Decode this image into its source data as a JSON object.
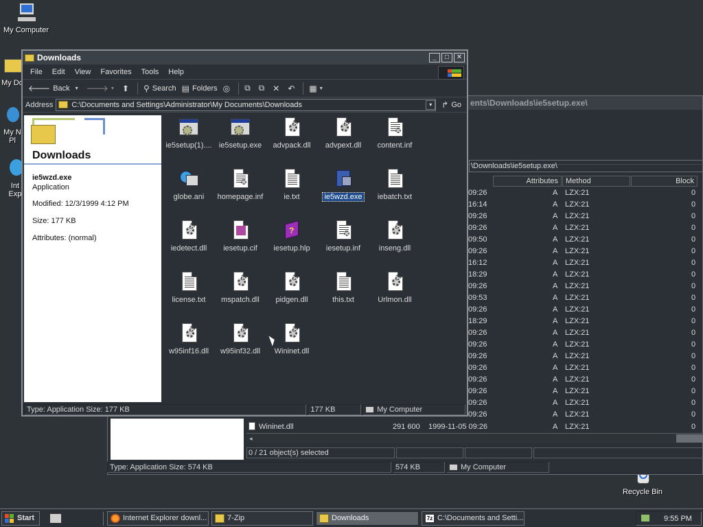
{
  "desktop": {
    "icons": [
      {
        "label": "My Computer",
        "icon": "my-computer-icon"
      },
      {
        "label": "My Do",
        "icon": "my-documents-icon"
      },
      {
        "label": "My N",
        "label2": "Pl",
        "icon": "my-network-places-icon"
      },
      {
        "label": "Int",
        "label2": "Exp",
        "icon": "internet-explorer-icon"
      },
      {
        "label": "Recycle Bin",
        "icon": "recycle-bin-icon"
      }
    ]
  },
  "bg_window": {
    "title_tail": "ents\\Downloads\\ie5setup.exe\\",
    "address_tail": "\\Downloads\\ie5setup.exe\\",
    "columns": [
      "Attributes",
      "Method",
      "Block"
    ],
    "rows": [
      {
        "time": "09:26",
        "attr": "A",
        "method": "LZX:21",
        "block": "0"
      },
      {
        "time": "16:14",
        "attr": "A",
        "method": "LZX:21",
        "block": "0"
      },
      {
        "time": "09:26",
        "attr": "A",
        "method": "LZX:21",
        "block": "0"
      },
      {
        "time": "09:26",
        "attr": "A",
        "method": "LZX:21",
        "block": "0"
      },
      {
        "time": "09:50",
        "attr": "A",
        "method": "LZX:21",
        "block": "0"
      },
      {
        "time": "09:26",
        "attr": "A",
        "method": "LZX:21",
        "block": "0"
      },
      {
        "time": "16:12",
        "attr": "A",
        "method": "LZX:21",
        "block": "0"
      },
      {
        "time": "18:29",
        "attr": "A",
        "method": "LZX:21",
        "block": "0"
      },
      {
        "time": "09:26",
        "attr": "A",
        "method": "LZX:21",
        "block": "0"
      },
      {
        "time": "09:53",
        "attr": "A",
        "method": "LZX:21",
        "block": "0"
      },
      {
        "time": "09:26",
        "attr": "A",
        "method": "LZX:21",
        "block": "0"
      },
      {
        "time": "18:29",
        "attr": "A",
        "method": "LZX:21",
        "block": "0"
      },
      {
        "time": "09:26",
        "attr": "A",
        "method": "LZX:21",
        "block": "0"
      },
      {
        "time": "09:26",
        "attr": "A",
        "method": "LZX:21",
        "block": "0"
      },
      {
        "time": "09:26",
        "attr": "A",
        "method": "LZX:21",
        "block": "0"
      },
      {
        "time": "09:26",
        "attr": "A",
        "method": "LZX:21",
        "block": "0"
      },
      {
        "time": "09:26",
        "attr": "A",
        "method": "LZX:21",
        "block": "0"
      },
      {
        "time": "09:26",
        "attr": "A",
        "method": "LZX:21",
        "block": "0"
      },
      {
        "time": "09:26",
        "attr": "A",
        "method": "LZX:21",
        "block": "0"
      },
      {
        "time": "09:26",
        "attr": "A",
        "method": "LZX:21",
        "block": "0"
      }
    ],
    "last_row": {
      "name": "Wininet.dll",
      "size": "291 600",
      "date": "1999-11-05 09:26",
      "attr": "A",
      "method": "LZX:21",
      "block": "0"
    },
    "selection_status": "0 / 21 object(s) selected",
    "status_type": "Type: Application Size: 574 KB",
    "status_size": "574 KB",
    "status_zone": "My Computer"
  },
  "window": {
    "title": "Downloads",
    "menu": [
      "File",
      "Edit",
      "View",
      "Favorites",
      "Tools",
      "Help"
    ],
    "toolbar": {
      "back": "Back",
      "search": "Search",
      "folders": "Folders"
    },
    "address_label": "Address",
    "address_value": "C:\\Documents and Settings\\Administrator\\My Documents\\Downloads",
    "go_label": "Go",
    "panel": {
      "folder_title": "Downloads",
      "file_name": "ie5wzd.exe",
      "file_type": "Application",
      "modified": "Modified: 12/3/1999 4:12 PM",
      "size": "Size: 177 KB",
      "attributes": "Attributes: (normal)"
    },
    "files": [
      {
        "name": "ie5setup(1)....",
        "kind": "prog"
      },
      {
        "name": "ie5setup.exe",
        "kind": "prog"
      },
      {
        "name": "advpack.dll",
        "kind": "dll"
      },
      {
        "name": "advpext.dll",
        "kind": "dll"
      },
      {
        "name": "content.inf",
        "kind": "inf"
      },
      {
        "name": "globe.ani",
        "kind": "ani"
      },
      {
        "name": "homepage.inf",
        "kind": "inf"
      },
      {
        "name": "ie.txt",
        "kind": "txt"
      },
      {
        "name": "ie5wzd.exe",
        "kind": "exe",
        "selected": true
      },
      {
        "name": "iebatch.txt",
        "kind": "txt"
      },
      {
        "name": "iedetect.dll",
        "kind": "dll"
      },
      {
        "name": "iesetup.cif",
        "kind": "cif"
      },
      {
        "name": "iesetup.hlp",
        "kind": "hlp"
      },
      {
        "name": "iesetup.inf",
        "kind": "inf"
      },
      {
        "name": "inseng.dll",
        "kind": "dll"
      },
      {
        "name": "license.txt",
        "kind": "txt"
      },
      {
        "name": "mspatch.dll",
        "kind": "dll"
      },
      {
        "name": "pidgen.dll",
        "kind": "dll"
      },
      {
        "name": "this.txt",
        "kind": "txt"
      },
      {
        "name": "Urlmon.dll",
        "kind": "dll"
      },
      {
        "name": "w95inf16.dll",
        "kind": "dll"
      },
      {
        "name": "w95inf32.dll",
        "kind": "dll"
      },
      {
        "name": "Wininet.dll",
        "kind": "dll"
      }
    ],
    "status_type": "Type: Application Size: 177 KB",
    "status_size": "177 KB",
    "status_zone": "My Computer"
  },
  "taskbar": {
    "start": "Start",
    "tasks": [
      {
        "label": "Internet Explorer downl...",
        "icon": "firefox-icon"
      },
      {
        "label": "7-Zip",
        "icon": "folder-icon"
      },
      {
        "label": "Downloads",
        "icon": "folder-icon",
        "active": true
      },
      {
        "label": "C:\\Documents and Setti...",
        "icon": "7zip-icon"
      }
    ],
    "clock": "9:55 PM"
  },
  "colors": {
    "desktop": "#2e3338",
    "selection": "#1c4a8c",
    "accent_blue": "#1e3c9a"
  }
}
